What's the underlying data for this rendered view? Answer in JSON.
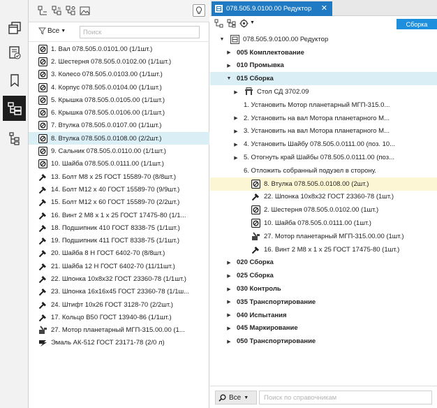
{
  "left_panel": {
    "filter_label": "Все",
    "search_placeholder": "Поиск",
    "items": [
      {
        "icon": "part",
        "text": "1. Вал 078.505.0.0101.00 (1/1шт.)"
      },
      {
        "icon": "part",
        "text": "2. Шестерня 078.505.0.0102.00 (1/1шт.)"
      },
      {
        "icon": "part",
        "text": "3. Колесо 078.505.0.0103.00 (1/1шт.)"
      },
      {
        "icon": "part",
        "text": "4. Корпус 078.505.0.0104.00 (1/1шт.)"
      },
      {
        "icon": "part",
        "text": "5. Крышка 078.505.0.0105.00 (1/1шт.)"
      },
      {
        "icon": "part",
        "text": "6. Крышка 078.505.0.0106.00 (1/1шт.)"
      },
      {
        "icon": "part",
        "text": "7. Втулка 078.505.0.0107.00 (1/1шт.)"
      },
      {
        "icon": "part",
        "text": "8. Втулка 078.505.0.0108.00 (2/2шт.)",
        "selected": true
      },
      {
        "icon": "part",
        "text": "9. Сальник 078.505.0.0110.00 (1/1шт.)"
      },
      {
        "icon": "part",
        "text": "10. Шайба 078.505.0.0111.00 (1/1шт.)"
      },
      {
        "icon": "bolt",
        "text": "13. Болт М8 х 25 ГОСТ 15589-70 (8/8шт.)"
      },
      {
        "icon": "bolt",
        "text": "14. Болт М12 х 40 ГОСТ 15589-70 (9/9шт.)"
      },
      {
        "icon": "bolt",
        "text": "15. Болт М12 х 60 ГОСТ 15589-70 (2/2шт.)"
      },
      {
        "icon": "bolt",
        "text": "16. Винт 2 М8 х 1 х 25 ГОСТ 17475-80 (1/1..."
      },
      {
        "icon": "bolt",
        "text": "18. Подшипник 410 ГОСТ 8338-75 (1/1шт.)"
      },
      {
        "icon": "bolt",
        "text": "19. Подшипник 411 ГОСТ 8338-75 (1/1шт.)"
      },
      {
        "icon": "bolt",
        "text": "20. Шайба 8 Н ГОСТ 6402-70 (8/8шт.)"
      },
      {
        "icon": "bolt",
        "text": "21. Шайба 12 Н ГОСТ 6402-70 (11/11шт.)"
      },
      {
        "icon": "bolt",
        "text": "22. Шпонка 10х8х32 ГОСТ 23360-78 (1/1шт.)"
      },
      {
        "icon": "bolt",
        "text": "23. Шпонка 16х16х45 ГОСТ 23360-78 (1/1ш..."
      },
      {
        "icon": "bolt",
        "text": "24. Штифт 10х26 ГОСТ 3128-70 (2/2шт.)"
      },
      {
        "icon": "bolt",
        "text": "17. Кольцо В50 ГОСТ 13940-86 (1/1шт.)"
      },
      {
        "icon": "motor",
        "text": "27. Мотор планетарный МГП-315.00.00 (1..."
      },
      {
        "icon": "paint",
        "text": "Эмаль АК-512 ГОСТ 23171-78 (2/0 л)"
      }
    ]
  },
  "right_panel": {
    "tab_title": "078.505.9.0100.00 Редуктор",
    "stage_badge": "Сборка",
    "tree": [
      {
        "level": 0,
        "arrow": "down",
        "icon": "assembly",
        "text": "078.505.9.0100.00 Редуктор",
        "bold": false
      },
      {
        "level": 1,
        "arrow": "right",
        "icon": "",
        "text": "005 Комплектование",
        "bold": true
      },
      {
        "level": 1,
        "arrow": "right",
        "icon": "",
        "text": "010 Промывка",
        "bold": true
      },
      {
        "level": 1,
        "arrow": "down",
        "icon": "",
        "text": "015 Сборка",
        "bold": true,
        "stage": true
      },
      {
        "level": 2,
        "arrow": "right",
        "icon": "table",
        "text": "Стол СД 3702.09",
        "bold": false
      },
      {
        "level": 2,
        "arrow": "",
        "icon": "",
        "text": "1. Установить Мотор планетарный МГП-315.0...",
        "bold": false
      },
      {
        "level": 2,
        "arrow": "right",
        "icon": "",
        "text": "2. Установить на вал Мотора планетарного М...",
        "bold": false
      },
      {
        "level": 2,
        "arrow": "right",
        "icon": "",
        "text": "3. Установить на вал Мотора планетарного М...",
        "bold": false
      },
      {
        "level": 2,
        "arrow": "right",
        "icon": "",
        "text": "4. Установить Шайбу 078.505.0.0111.00 (поз. 10...",
        "bold": false
      },
      {
        "level": 2,
        "arrow": "right",
        "icon": "",
        "text": "5. Отогнуть край Шайбы 078.505.0.0111.00 (поз...",
        "bold": false
      },
      {
        "level": 2,
        "arrow": "",
        "icon": "",
        "text": "6. Отложить собранный подузел в сторону.",
        "bold": false
      },
      {
        "level": 3,
        "arrow": "",
        "icon": "part",
        "text": "8. Втулка 078.505.0.0108.00 (2шт.)",
        "bold": false,
        "selected": true
      },
      {
        "level": 3,
        "arrow": "",
        "icon": "bolt",
        "text": "22. Шпонка 10х8х32 ГОСТ 23360-78 (1шт.)",
        "bold": false
      },
      {
        "level": 3,
        "arrow": "",
        "icon": "part",
        "text": "2. Шестерня 078.505.0.0102.00 (1шт.)",
        "bold": false
      },
      {
        "level": 3,
        "arrow": "",
        "icon": "part",
        "text": "10. Шайба 078.505.0.0111.00 (1шт.)",
        "bold": false
      },
      {
        "level": 3,
        "arrow": "",
        "icon": "motor",
        "text": "27. Мотор планетарный МГП-315.00.00 (1шт.)",
        "bold": false
      },
      {
        "level": 3,
        "arrow": "",
        "icon": "bolt",
        "text": "16. Винт 2 М8 х 1 х 25 ГОСТ 17475-80 (1шт.)",
        "bold": false
      },
      {
        "level": 1,
        "arrow": "right",
        "icon": "",
        "text": "020 Сборка",
        "bold": true
      },
      {
        "level": 1,
        "arrow": "right",
        "icon": "",
        "text": "025 Сборка",
        "bold": true
      },
      {
        "level": 1,
        "arrow": "right",
        "icon": "",
        "text": "030 Контроль",
        "bold": true
      },
      {
        "level": 1,
        "arrow": "right",
        "icon": "",
        "text": "035 Транспортирование",
        "bold": true
      },
      {
        "level": 1,
        "arrow": "right",
        "icon": "",
        "text": "040 Испытания",
        "bold": true
      },
      {
        "level": 1,
        "arrow": "right",
        "icon": "",
        "text": "045 Маркирование",
        "bold": true
      },
      {
        "level": 1,
        "arrow": "right",
        "icon": "",
        "text": "050 Транспортирование",
        "bold": true
      }
    ],
    "bottom_search_label": "Все",
    "bottom_search_placeholder": "Поиск по справочникам"
  },
  "colors": {
    "tab_active": "#1f7ac3",
    "stage_badge": "#1e8fdc",
    "selected_left": "#d9eef5",
    "selected_tree": "#fdf6d5",
    "rail_active": "#1e1e1e"
  }
}
